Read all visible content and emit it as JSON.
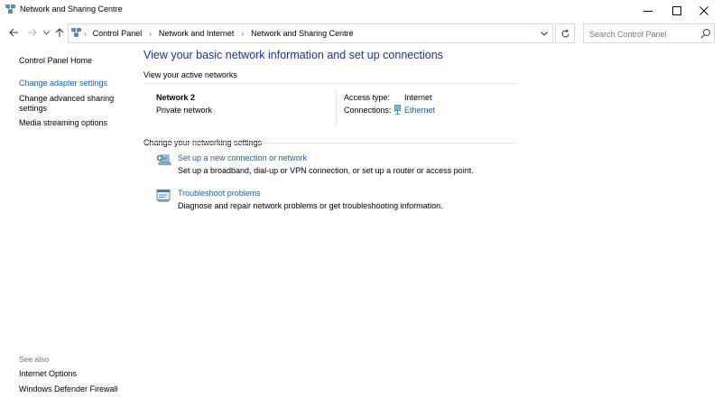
{
  "window": {
    "title": "Network and Sharing Centre"
  },
  "address_bar": {
    "breadcrumbs": [
      "Control Panel",
      "Network and Internet",
      "Network and Sharing Centre"
    ]
  },
  "search": {
    "placeholder": "Search Control Panel"
  },
  "left_pane": {
    "links": [
      "Control Panel Home",
      "Change adapter settings",
      "Change advanced sharing",
      "settings",
      "Media streaming options"
    ],
    "see_also_label": "See also",
    "see_also": [
      "Internet Options",
      "Windows Defender Firewall"
    ]
  },
  "main": {
    "heading": "View your basic network information and set up connections",
    "active_networks_label": "View your active networks",
    "network": {
      "name": "Network 2",
      "category": "Private network",
      "access_type_label": "Access type:",
      "access_type_value": "Internet",
      "connections_label": "Connections:",
      "connections_value": "Ethernet"
    },
    "change_settings_label": "Change your networking settings",
    "tasks": [
      {
        "icon": "network-setup-icon",
        "title": "Set up a new connection or network",
        "description": "Set up a broadband, dial-up or VPN connection, or set up a router or access point."
      },
      {
        "icon": "troubleshoot-icon",
        "title": "Troubleshoot problems",
        "description": "Diagnose and repair network problems or get troubleshooting information."
      }
    ]
  },
  "colors": {
    "heading": "#1e3287",
    "link": "#1a5fa8",
    "border": "#d9d9d9"
  }
}
